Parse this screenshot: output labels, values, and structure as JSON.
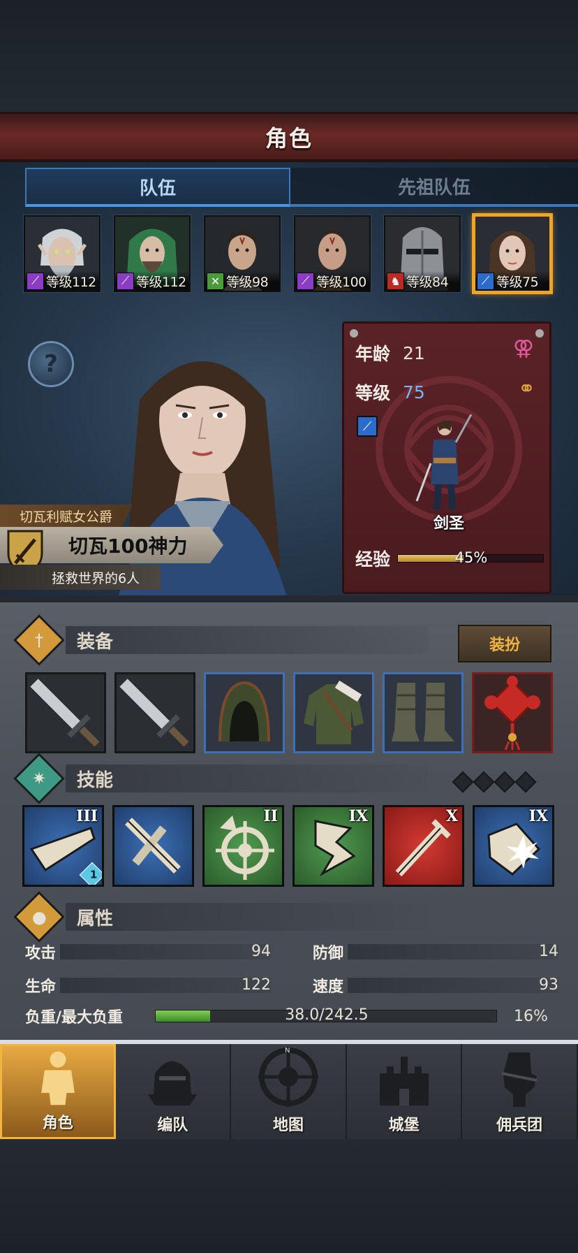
{
  "header": {
    "title": "角色"
  },
  "tabs": [
    {
      "label": "队伍",
      "active": true
    },
    {
      "label": "先祖队伍",
      "active": false
    }
  ],
  "roster": [
    {
      "level_text": "等级112",
      "class_icon": "staff-icon",
      "badge_color": "#8a3cc4",
      "selected": false
    },
    {
      "level_text": "等级112",
      "class_icon": "staff-icon",
      "badge_color": "#8a3cc4",
      "selected": false
    },
    {
      "level_text": "等级98",
      "class_icon": "bow-icon",
      "badge_color": "#4b9b3c",
      "selected": false
    },
    {
      "level_text": "等级100",
      "class_icon": "staff-icon",
      "badge_color": "#8a3cc4",
      "selected": false
    },
    {
      "level_text": "等级84",
      "class_icon": "horse-icon",
      "badge_color": "#b92c25",
      "selected": false
    },
    {
      "level_text": "等级75",
      "class_icon": "sword-icon",
      "badge_color": "#2b6bcc",
      "selected": true
    }
  ],
  "character": {
    "title": "切瓦利赋女公爵",
    "name": "切瓦100神力",
    "subtitle": "拯救世界的6人",
    "age_label": "年龄",
    "age": "21",
    "level_label": "等级",
    "level": "75",
    "class_name": "剑圣",
    "exp_label": "经验",
    "exp_text": "45%",
    "exp_fraction": 0.45
  },
  "equipment": {
    "title": "装备",
    "dress_button": "装扮",
    "slots": [
      {
        "item": "sword-icon",
        "rarity": "common"
      },
      {
        "item": "sword-icon",
        "rarity": "common"
      },
      {
        "item": "hood-icon",
        "rarity": "rare"
      },
      {
        "item": "tunic-icon",
        "rarity": "rare"
      },
      {
        "item": "boots-icon",
        "rarity": "rare"
      },
      {
        "item": "knot-charm-icon",
        "rarity": "legendary"
      }
    ]
  },
  "skills": {
    "title": "技能",
    "items": [
      {
        "rank": "III",
        "color": "blue",
        "icon": "slash-icon",
        "badge": "1"
      },
      {
        "rank": "",
        "color": "blue",
        "icon": "crossed-strike-icon",
        "badge": ""
      },
      {
        "rank": "II",
        "color": "green",
        "icon": "target-icon",
        "badge": ""
      },
      {
        "rank": "IX",
        "color": "green",
        "icon": "flourish-icon",
        "badge": ""
      },
      {
        "rank": "X",
        "color": "red",
        "icon": "sword-thrust-icon",
        "badge": ""
      },
      {
        "rank": "IX",
        "color": "blue",
        "icon": "shield-burst-icon",
        "badge": ""
      }
    ]
  },
  "attributes": {
    "title": "属性",
    "attack_label": "攻击",
    "attack": "94",
    "defense_label": "防御",
    "defense": "14",
    "hp_label": "生命",
    "hp": "122",
    "speed_label": "速度",
    "speed": "93",
    "weight_label": "负重/最大负重",
    "weight_text": "38.0/242.5",
    "weight_pct": "16%",
    "weight_fraction": 0.16
  },
  "nav": [
    {
      "label": "角色",
      "active": true
    },
    {
      "label": "编队",
      "active": false
    },
    {
      "label": "地图",
      "active": false
    },
    {
      "label": "城堡",
      "active": false
    },
    {
      "label": "佣兵团",
      "active": false
    }
  ]
}
